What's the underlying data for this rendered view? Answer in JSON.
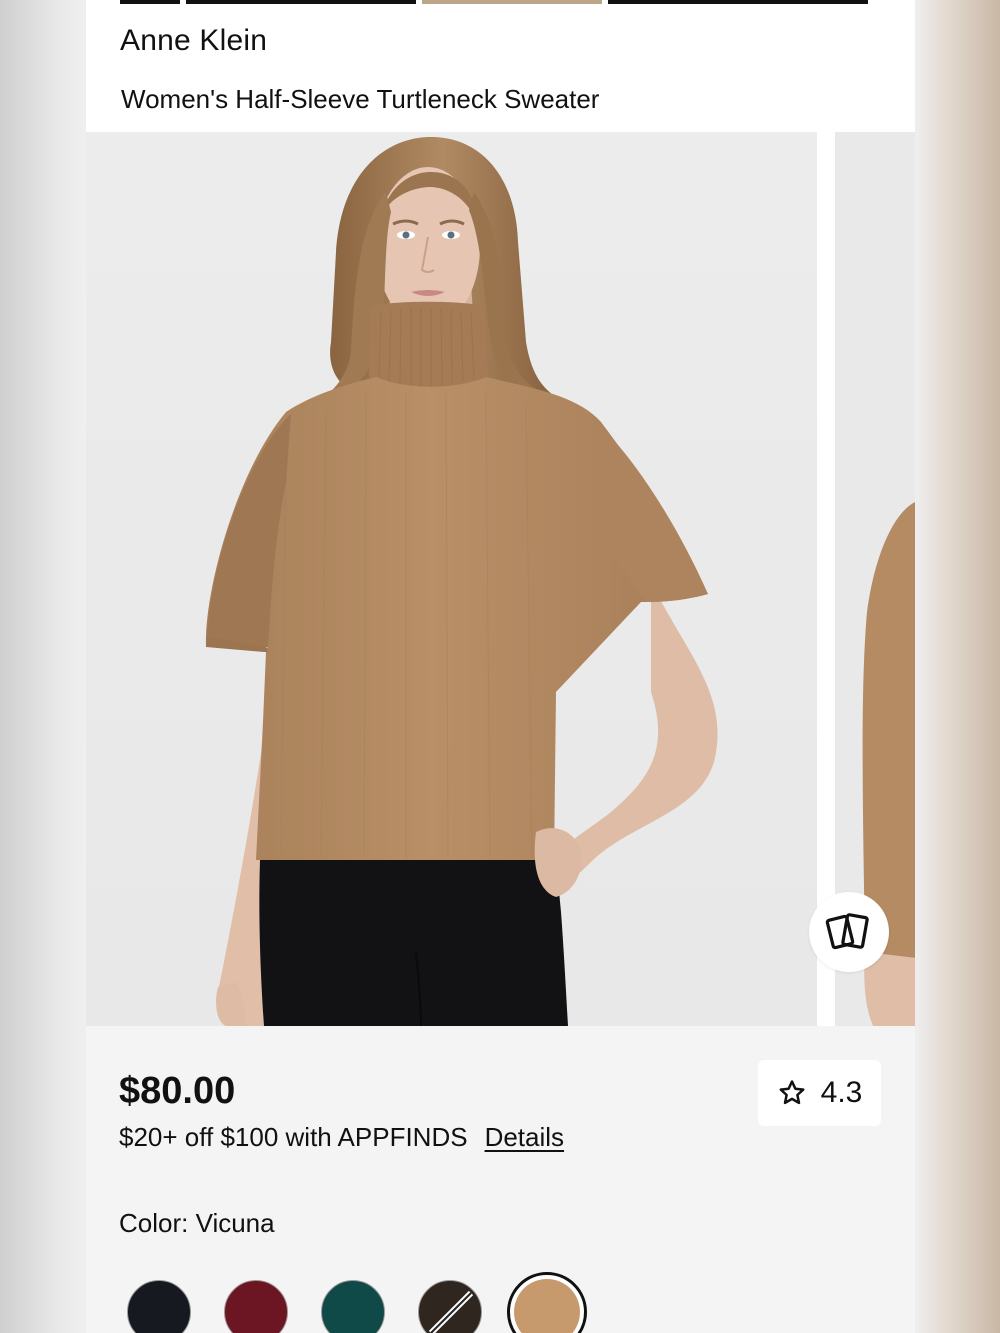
{
  "header": {
    "brand": "Anne Klein",
    "product_title": "Women's Half-Sleeve Turtleneck Sweater"
  },
  "gallery": {
    "main_image": "model-wearing-camel-turtleneck-sweater",
    "next_image": "sweater-detail-preview",
    "compare_icon": "cards-icon"
  },
  "pricing": {
    "price": "$80.00",
    "promo_text": "$20+ off $100 with APPFINDS",
    "details_link": "Details"
  },
  "rating": {
    "icon": "star-outline-icon",
    "value": "4.3"
  },
  "color": {
    "label": "Color: Vicuna",
    "swatches": [
      {
        "name": "black",
        "hex": "#16191f",
        "selected": false
      },
      {
        "name": "burgundy",
        "hex": "#6b1622",
        "selected": false
      },
      {
        "name": "green",
        "hex": "#0f4a48",
        "selected": false
      },
      {
        "name": "brown-unavailable",
        "hex": "#2f2620",
        "selected": false
      },
      {
        "name": "vicuna",
        "hex": "#c79a6e",
        "selected": true
      }
    ]
  },
  "colors": {
    "sweater": "#b38a63",
    "pants": "#121214",
    "skin": "#e3c2ad",
    "hair": "#9b7550"
  }
}
